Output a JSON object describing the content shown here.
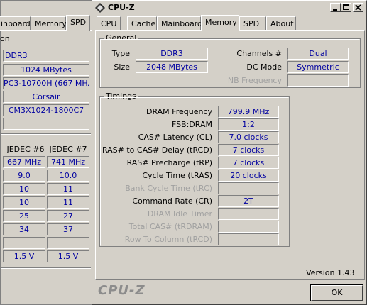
{
  "background_window": {
    "tabs": [
      "inboard",
      "Memory",
      "SPD"
    ],
    "side_label": "on",
    "spd_fields": [
      "DDR3",
      "1024 MBytes",
      "PC3-10700H (667 MHz)",
      "Corsair",
      "CM3X1024-1800C7",
      ""
    ],
    "jedec_headers": [
      "JEDEC #6",
      "JEDEC #7"
    ],
    "jedec_rows": [
      [
        "667 MHz",
        "741 MHz"
      ],
      [
        "9.0",
        "10.0"
      ],
      [
        "10",
        "11"
      ],
      [
        "10",
        "11"
      ],
      [
        "25",
        "27"
      ],
      [
        "34",
        "37"
      ],
      [
        "",
        ""
      ],
      [
        "1.5 V",
        "1.5 V"
      ]
    ]
  },
  "window": {
    "title": "CPU-Z",
    "tabs": [
      "CPU",
      "Cache",
      "Mainboard",
      "Memory",
      "SPD",
      "About"
    ],
    "active_tab": "Memory",
    "general": {
      "title": "General",
      "type_label": "Type",
      "type_value": "DDR3",
      "size_label": "Size",
      "size_value": "2048 MBytes",
      "channels_label": "Channels #",
      "channels_value": "Dual",
      "dcmode_label": "DC Mode",
      "dcmode_value": "Symmetric",
      "nbfreq_label": "NB Frequency",
      "nbfreq_value": ""
    },
    "timings": {
      "title": "Timings",
      "rows": [
        {
          "label": "DRAM Frequency",
          "value": "799.9 MHz",
          "disabled": false
        },
        {
          "label": "FSB:DRAM",
          "value": "1:2",
          "disabled": false
        },
        {
          "label": "CAS# Latency (CL)",
          "value": "7.0 clocks",
          "disabled": false
        },
        {
          "label": "RAS# to CAS# Delay (tRCD)",
          "value": "7 clocks",
          "disabled": false
        },
        {
          "label": "RAS# Precharge (tRP)",
          "value": "7 clocks",
          "disabled": false
        },
        {
          "label": "Cycle Time (tRAS)",
          "value": "20 clocks",
          "disabled": false
        },
        {
          "label": "Bank Cycle Time (tRC)",
          "value": "",
          "disabled": true
        },
        {
          "label": "Command Rate (CR)",
          "value": "2T",
          "disabled": false
        },
        {
          "label": "DRAM Idle Timer",
          "value": "",
          "disabled": true
        },
        {
          "label": "Total CAS# (tRDRAM)",
          "value": "",
          "disabled": true
        },
        {
          "label": "Row To Column (tRCD)",
          "value": "",
          "disabled": true
        }
      ]
    },
    "version": "Version 1.43",
    "brand": "CPU-Z",
    "ok_label": "OK"
  }
}
